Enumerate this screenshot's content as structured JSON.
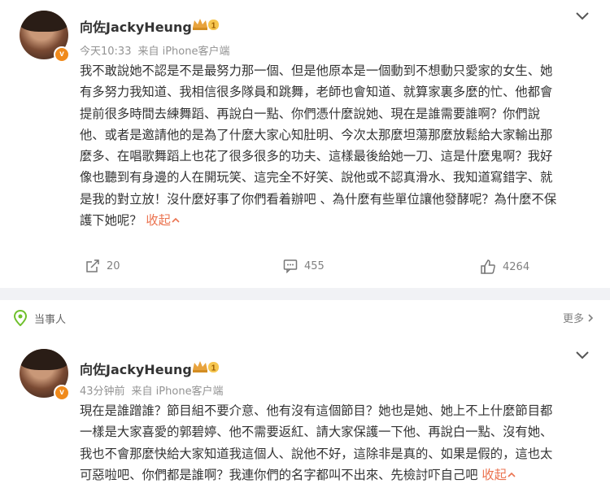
{
  "post1": {
    "author": "向佐JackyHeung",
    "badge_level": "1",
    "time": "今天10:33",
    "source": "来自 iPhone客户端",
    "lines": [
      "我不敢說她不認是不是最努力那一個、但是他原本是一個動到不想動只愛家的女生、她",
      "有多努力我知道、我相信很多隊員和跳舞，老師也會知道、就算家裏多麼的忙、他都會",
      "提前很多時間去練舞蹈、再說白一點、你們憑什麼說她、現在是誰需要誰啊？你們說",
      "他、或者是邀請他的是為了什麼大家心知肚明、今次太那麼坦蕩那麼放鬆給大家輸出那",
      "麼多、在唱歌舞蹈上也花了很多很多的功夫、這樣最後給她一刀、這是什麼鬼啊？我好",
      "像也聽到有身邊的人在開玩笑、這完全不好笑、說他或不認真滑水、我知道寫錯字、就",
      "是我的對立放！沒什麼好事了你們看着辦吧 、為什麼有些單位讓他發酵呢？為什麼不保"
    ],
    "last_line": "護下她呢？",
    "fold_label": "收起",
    "repost_count": "20",
    "comment_count": "455",
    "like_count": "4264"
  },
  "post2": {
    "topic_label": "当事人",
    "more_label": "更多",
    "author": "向佐JackyHeung",
    "badge_level": "1",
    "time": "43分钟前",
    "source": "来自 iPhone客户端",
    "lines": [
      "現在是誰蹭誰？節目組不要介意、他有沒有這個節目？她也是她、她上不上什麼節目都",
      "一樣是大家喜愛的郭碧婷、他不需要返紅、請大家保護一下他、再說白一點、沒有她、",
      "我也不會那麼快給大家知道我這個人、說他不好，這除非是真的、如果是假的，這也太"
    ],
    "last_line": "可惡啦吧、你們都是誰啊？我連你們的名字都叫不出來、先檢討吓自己吧 ",
    "fold_label": "收起"
  },
  "colors": {
    "accent": "#eb7350",
    "meta": "#939393",
    "badge": "#f08a1b"
  },
  "icons": [
    "chevron-down-icon",
    "verified-icon",
    "medal-icon",
    "repost-icon",
    "comment-icon",
    "like-icon",
    "location-pin-icon",
    "chevron-right-icon",
    "chevron-up-icon"
  ]
}
